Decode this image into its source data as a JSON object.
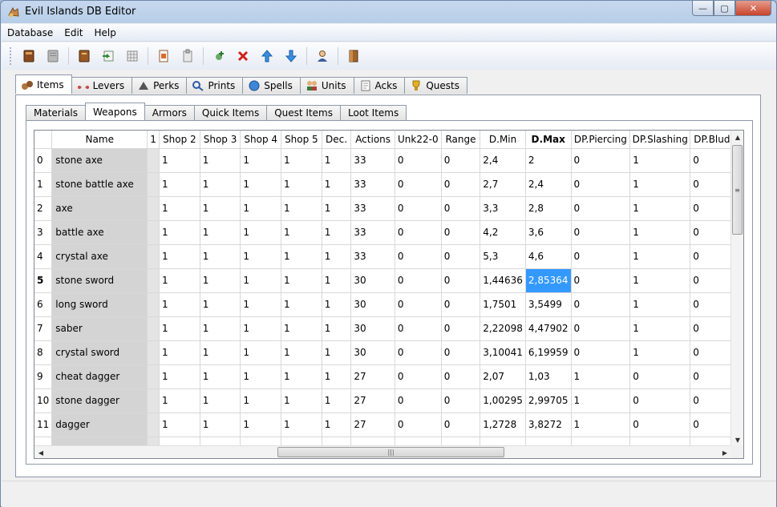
{
  "window": {
    "title": "Evil Islands DB Editor",
    "minimize": "—",
    "maximize": "▢",
    "close": "✕"
  },
  "menu": [
    {
      "label": "Database"
    },
    {
      "label": "Edit"
    },
    {
      "label": "Help"
    }
  ],
  "outer_tabs": [
    {
      "label": "Items",
      "icon": "items-icon",
      "active": true
    },
    {
      "label": "Levers",
      "icon": "levers-icon"
    },
    {
      "label": "Perks",
      "icon": "perks-icon"
    },
    {
      "label": "Prints",
      "icon": "prints-icon"
    },
    {
      "label": "Spells",
      "icon": "spells-icon"
    },
    {
      "label": "Units",
      "icon": "units-icon"
    },
    {
      "label": "Acks",
      "icon": "acks-icon"
    },
    {
      "label": "Quests",
      "icon": "quests-icon"
    }
  ],
  "inner_tabs": [
    {
      "label": "Materials"
    },
    {
      "label": "Weapons",
      "active": true
    },
    {
      "label": "Armors"
    },
    {
      "label": "Quick Items"
    },
    {
      "label": "Quest Items"
    },
    {
      "label": "Loot Items"
    }
  ],
  "table": {
    "columns": [
      "Name",
      "1",
      "Shop 2",
      "Shop 3",
      "Shop 4",
      "Shop 5",
      "Dec.",
      "Actions",
      "Unk22-0",
      "Range",
      "D.Min",
      "D.Max",
      "DP.Piercing",
      "DP.Slashing",
      "DP.Bludg."
    ],
    "rows": [
      {
        "idx": "0",
        "cells": [
          "stone axe",
          "",
          "1",
          "1",
          "1",
          "1",
          "1",
          "33",
          "0",
          "0",
          "2,4",
          "2",
          "0",
          "1",
          "0"
        ]
      },
      {
        "idx": "1",
        "cells": [
          "stone battle axe",
          "",
          "1",
          "1",
          "1",
          "1",
          "1",
          "33",
          "0",
          "0",
          "2,7",
          "2,4",
          "0",
          "1",
          "0"
        ]
      },
      {
        "idx": "2",
        "cells": [
          "axe",
          "",
          "1",
          "1",
          "1",
          "1",
          "1",
          "33",
          "0",
          "0",
          "3,3",
          "2,8",
          "0",
          "1",
          "0"
        ]
      },
      {
        "idx": "3",
        "cells": [
          "battle axe",
          "",
          "1",
          "1",
          "1",
          "1",
          "1",
          "33",
          "0",
          "0",
          "4,2",
          "3,6",
          "0",
          "1",
          "0"
        ]
      },
      {
        "idx": "4",
        "cells": [
          "crystal axe",
          "",
          "1",
          "1",
          "1",
          "1",
          "1",
          "33",
          "0",
          "0",
          "5,3",
          "4,6",
          "0",
          "1",
          "0"
        ]
      },
      {
        "idx": "5",
        "cells": [
          "stone sword",
          "",
          "1",
          "1",
          "1",
          "1",
          "1",
          "30",
          "0",
          "0",
          "1,44636",
          "2,85364",
          "0",
          "1",
          "0"
        ]
      },
      {
        "idx": "6",
        "cells": [
          "long sword",
          "",
          "1",
          "1",
          "1",
          "1",
          "1",
          "30",
          "0",
          "0",
          "1,7501",
          "3,5499",
          "0",
          "1",
          "0"
        ]
      },
      {
        "idx": "7",
        "cells": [
          "saber",
          "",
          "1",
          "1",
          "1",
          "1",
          "1",
          "30",
          "0",
          "0",
          "2,22098",
          "4,47902",
          "0",
          "1",
          "0"
        ]
      },
      {
        "idx": "8",
        "cells": [
          "crystal sword",
          "",
          "1",
          "1",
          "1",
          "1",
          "1",
          "30",
          "0",
          "0",
          "3,10041",
          "6,19959",
          "0",
          "1",
          "0"
        ]
      },
      {
        "idx": "9",
        "cells": [
          "cheat dagger",
          "",
          "1",
          "1",
          "1",
          "1",
          "1",
          "27",
          "0",
          "0",
          "2,07",
          "1,03",
          "1",
          "0",
          "0"
        ]
      },
      {
        "idx": "10",
        "cells": [
          "stone dagger",
          "",
          "1",
          "1",
          "1",
          "1",
          "1",
          "27",
          "0",
          "0",
          "1,00295",
          "2,99705",
          "1",
          "0",
          "0"
        ]
      },
      {
        "idx": "11",
        "cells": [
          "dagger",
          "",
          "1",
          "1",
          "1",
          "1",
          "1",
          "27",
          "0",
          "0",
          "1,2728",
          "3,8272",
          "1",
          "0",
          "0"
        ]
      },
      {
        "idx": "",
        "cells": [
          "",
          "",
          "",
          "",
          "",
          "",
          "",
          "",
          "",
          "",
          "",
          "",
          "",
          "",
          ""
        ]
      }
    ],
    "selected_row": "5",
    "selected_col": 11,
    "bold_header": "D.Max"
  },
  "colors": {
    "selection": "#3399ff",
    "name_column": "#d4d4d4"
  }
}
